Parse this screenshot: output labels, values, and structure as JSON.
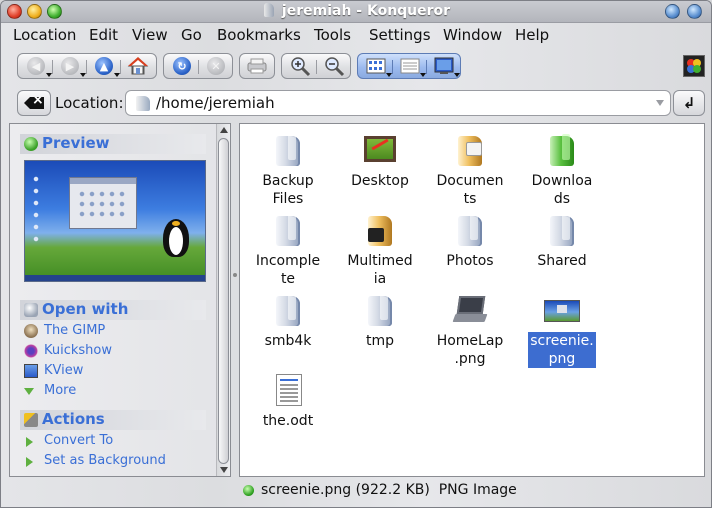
{
  "window": {
    "title": "jeremiah - Konqueror"
  },
  "menu": [
    {
      "label": "Location",
      "accel": "L"
    },
    {
      "label": "Edit",
      "accel": "E"
    },
    {
      "label": "View",
      "accel": "V"
    },
    {
      "label": "Go",
      "accel": "G"
    },
    {
      "label": "Bookmarks",
      "accel": "B"
    },
    {
      "label": "Tools",
      "accel": "T"
    },
    {
      "label": "Settings",
      "accel": "S"
    },
    {
      "label": "Window",
      "accel": "W"
    },
    {
      "label": "Help",
      "accel": "H"
    }
  ],
  "location": {
    "label": "Location:",
    "value": "/home/jeremiah"
  },
  "sidebar": {
    "preview_title": "Preview",
    "openwith_title": "Open with",
    "openwith_items": [
      "The GIMP",
      "Kuickshow",
      "KView",
      "More"
    ],
    "actions_title": "Actions",
    "actions_items": [
      "Convert To",
      "Set as Background"
    ]
  },
  "files": [
    {
      "name": "Backup Files",
      "lines": [
        "Backup",
        "Files"
      ],
      "icon": "folder-icon"
    },
    {
      "name": "Desktop",
      "lines": [
        "Desktop"
      ],
      "icon": "desktop-folder-icon"
    },
    {
      "name": "Documents",
      "lines": [
        "Documen",
        "ts"
      ],
      "icon": "documents-folder-icon"
    },
    {
      "name": "Downloads",
      "lines": [
        "Downloa",
        "ds"
      ],
      "icon": "downloads-folder-icon"
    },
    {
      "name": "Incomplete",
      "lines": [
        "Incomple",
        "te"
      ],
      "icon": "folder-icon"
    },
    {
      "name": "Multimedia",
      "lines": [
        "Multimed",
        "ia"
      ],
      "icon": "multimedia-folder-icon"
    },
    {
      "name": "Photos",
      "lines": [
        "Photos"
      ],
      "icon": "folder-icon"
    },
    {
      "name": "Shared",
      "lines": [
        "Shared"
      ],
      "icon": "folder-icon"
    },
    {
      "name": "smb4k",
      "lines": [
        "smb4k"
      ],
      "icon": "folder-icon"
    },
    {
      "name": "tmp",
      "lines": [
        "tmp"
      ],
      "icon": "folder-icon"
    },
    {
      "name": "HomeLap.png",
      "lines": [
        "HomeLap",
        ".png"
      ],
      "icon": "laptop-image-icon"
    },
    {
      "name": "screenie.png",
      "lines": [
        "screenie.",
        "png"
      ],
      "icon": "screenshot-image-icon",
      "selected": true
    },
    {
      "name": "the.odt",
      "lines": [
        "the.odt"
      ],
      "icon": "document-icon"
    }
  ],
  "status": {
    "text": "screenie.png (922.2 KB)  PNG Image"
  },
  "colors": {
    "accent": "#3a6fd6",
    "selection": "#3d6dd0"
  }
}
